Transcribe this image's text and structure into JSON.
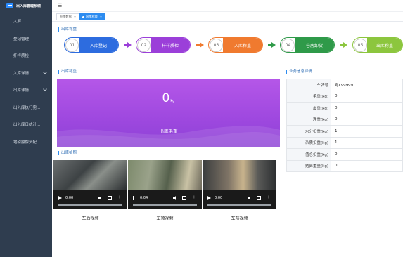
{
  "app": {
    "title": "出入库管理系统"
  },
  "sidebar": {
    "items": [
      {
        "label": "大屏",
        "has_children": false
      },
      {
        "label": "登记管理",
        "has_children": false
      },
      {
        "label": "扦样质检",
        "has_children": false
      },
      {
        "label": "入库详情",
        "has_children": true
      },
      {
        "label": "出库详情",
        "has_children": true
      },
      {
        "label": "出入库执行完...",
        "has_children": false
      },
      {
        "label": "出入库日统计...",
        "has_children": false
      },
      {
        "label": "地磅摄像头配...",
        "has_children": false
      }
    ]
  },
  "tabs": [
    {
      "label": "仓库数据",
      "active": false
    },
    {
      "label": "出库称重",
      "active": true
    }
  ],
  "steps_section": {
    "title": "出库称重"
  },
  "steps": [
    {
      "num": "01",
      "label": "入库登记",
      "color": "#2d6cdf"
    },
    {
      "num": "02",
      "label": "扦样质检",
      "color": "#9b3fd9"
    },
    {
      "num": "03",
      "label": "入库称重",
      "color": "#f07a2f"
    },
    {
      "num": "04",
      "label": "仓房卸货",
      "color": "#2f9a49"
    },
    {
      "num": "05",
      "label": "出库称重",
      "color": "#8cc63e"
    }
  ],
  "weight_section": {
    "title": "出库称重"
  },
  "weight": {
    "value": "0",
    "unit": "kg",
    "caption": "出库毛重"
  },
  "photo_section": {
    "title": "出库拍照"
  },
  "videos": [
    {
      "time": "0:00",
      "playing": false,
      "label": "车后视频"
    },
    {
      "time": "0:04",
      "playing": true,
      "label": "车顶视频"
    },
    {
      "time": "0:00",
      "playing": false,
      "label": "车前视频"
    }
  ],
  "detail_section": {
    "title": "业务信息详情"
  },
  "details": [
    {
      "key": "车牌号",
      "value": "粤L99999"
    },
    {
      "key": "毛重(kg)",
      "value": "0"
    },
    {
      "key": "皮重(kg)",
      "value": "0"
    },
    {
      "key": "净重(kg)",
      "value": "0"
    },
    {
      "key": "水分扣重(kg)",
      "value": "1"
    },
    {
      "key": "杂质扣重(kg)",
      "value": "1"
    },
    {
      "key": "值仓扣重(kg)",
      "value": "0"
    },
    {
      "key": "结算重量(kg)",
      "value": "0"
    }
  ]
}
